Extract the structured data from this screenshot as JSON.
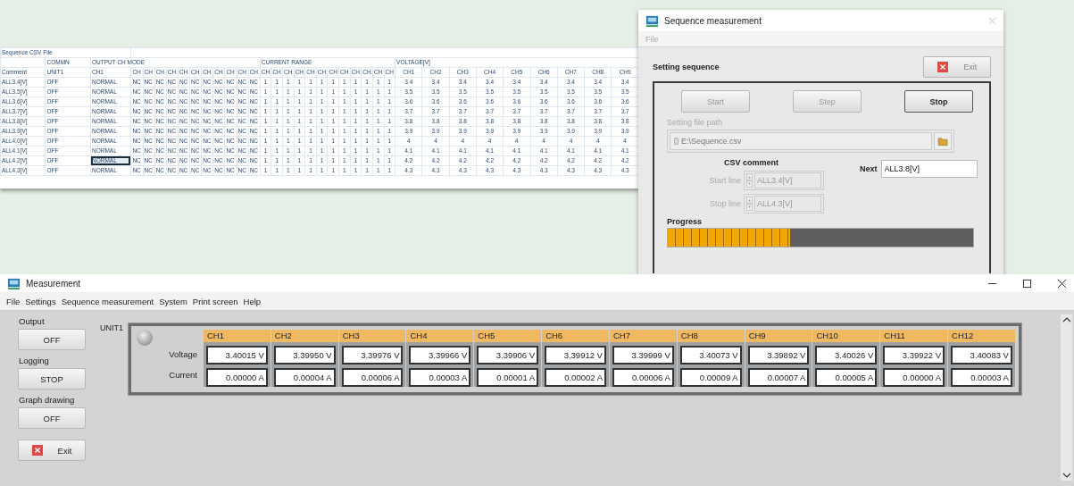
{
  "spreadsheet": {
    "title": "Sequence CSV File",
    "group_headers": [
      {
        "label": "COMMN",
        "kind": "unit"
      },
      {
        "label": "OUTPUT CH MODE",
        "kind": "mode"
      },
      {
        "label": "CURRENT RANGE",
        "kind": "range"
      },
      {
        "label": "VOLTAGE[V]",
        "kind": "voltage"
      }
    ],
    "columns": {
      "comment": "Comment",
      "unit": "UNIT1",
      "mode": [
        "CH1",
        "CH",
        "CH",
        "CH",
        "CH",
        "CH",
        "CH",
        "CH",
        "CH",
        "CH",
        "CH",
        "CH"
      ],
      "range": [
        "CH",
        "CH",
        "CH",
        "CH",
        "CH",
        "CH",
        "CH",
        "CH",
        "CH",
        "CH",
        "CH",
        "CH"
      ],
      "voltage": [
        "CH1",
        "CH2",
        "CH3",
        "CH4",
        "CH5",
        "CH6",
        "CH7",
        "CH8",
        "CH9"
      ]
    },
    "rows": [
      {
        "comment": "ALL3.4[V]",
        "unit": "OFF",
        "selected": false,
        "modes": [
          "NORMAL",
          "NC",
          "NC",
          "NC",
          "NC",
          "NC",
          "NC",
          "NC",
          "NC",
          "NC",
          "NC",
          "NC"
        ],
        "ranges": [
          "1",
          "1",
          "1",
          "1",
          "1",
          "1",
          "1",
          "1",
          "1",
          "1",
          "1",
          "1"
        ],
        "voltages": [
          "3.4",
          "3.4",
          "3.4",
          "3.4",
          "3.4",
          "3.4",
          "3.4",
          "3.4",
          "3.4"
        ]
      },
      {
        "comment": "ALL3.5[V]",
        "unit": "OFF",
        "selected": false,
        "modes": [
          "NORMAL",
          "NC",
          "NC",
          "NC",
          "NC",
          "NC",
          "NC",
          "NC",
          "NC",
          "NC",
          "NC",
          "NC"
        ],
        "ranges": [
          "1",
          "1",
          "1",
          "1",
          "1",
          "1",
          "1",
          "1",
          "1",
          "1",
          "1",
          "1"
        ],
        "voltages": [
          "3.5",
          "3.5",
          "3.5",
          "3.5",
          "3.5",
          "3.5",
          "3.5",
          "3.5",
          "3.5"
        ]
      },
      {
        "comment": "ALL3.6[V]",
        "unit": "OFF",
        "selected": false,
        "modes": [
          "NORMAL",
          "NC",
          "NC",
          "NC",
          "NC",
          "NC",
          "NC",
          "NC",
          "NC",
          "NC",
          "NC",
          "NC"
        ],
        "ranges": [
          "1",
          "1",
          "1",
          "1",
          "1",
          "1",
          "1",
          "1",
          "1",
          "1",
          "1",
          "1"
        ],
        "voltages": [
          "3.6",
          "3.6",
          "3.6",
          "3.6",
          "3.6",
          "3.6",
          "3.6",
          "3.6",
          "3.6"
        ]
      },
      {
        "comment": "ALL3.7[V]",
        "unit": "OFF",
        "selected": false,
        "modes": [
          "NORMAL",
          "NC",
          "NC",
          "NC",
          "NC",
          "NC",
          "NC",
          "NC",
          "NC",
          "NC",
          "NC",
          "NC"
        ],
        "ranges": [
          "1",
          "1",
          "1",
          "1",
          "1",
          "1",
          "1",
          "1",
          "1",
          "1",
          "1",
          "1"
        ],
        "voltages": [
          "3.7",
          "3.7",
          "3.7",
          "3.7",
          "3.7",
          "3.7",
          "3.7",
          "3.7",
          "3.7"
        ]
      },
      {
        "comment": "ALL3.8[V]",
        "unit": "OFF",
        "selected": false,
        "modes": [
          "NORMAL",
          "NC",
          "NC",
          "NC",
          "NC",
          "NC",
          "NC",
          "NC",
          "NC",
          "NC",
          "NC",
          "NC"
        ],
        "ranges": [
          "1",
          "1",
          "1",
          "1",
          "1",
          "1",
          "1",
          "1",
          "1",
          "1",
          "1",
          "1"
        ],
        "voltages": [
          "3.8",
          "3.8",
          "3.8",
          "3.8",
          "3.8",
          "3.8",
          "3.8",
          "3.8",
          "3.8"
        ]
      },
      {
        "comment": "ALL3.9[V]",
        "unit": "OFF",
        "selected": false,
        "modes": [
          "NORMAL",
          "NC",
          "NC",
          "NC",
          "NC",
          "NC",
          "NC",
          "NC",
          "NC",
          "NC",
          "NC",
          "NC"
        ],
        "ranges": [
          "1",
          "1",
          "1",
          "1",
          "1",
          "1",
          "1",
          "1",
          "1",
          "1",
          "1",
          "1"
        ],
        "voltages": [
          "3.9",
          "3.9",
          "3.9",
          "3.9",
          "3.9",
          "3.9",
          "3.9",
          "3.9",
          "3.9"
        ]
      },
      {
        "comment": "ALL4.0[V]",
        "unit": "OFF",
        "selected": false,
        "modes": [
          "NORMAL",
          "NC",
          "NC",
          "NC",
          "NC",
          "NC",
          "NC",
          "NC",
          "NC",
          "NC",
          "NC",
          "NC"
        ],
        "ranges": [
          "1",
          "1",
          "1",
          "1",
          "1",
          "1",
          "1",
          "1",
          "1",
          "1",
          "1",
          "1"
        ],
        "voltages": [
          "4",
          "4",
          "4",
          "4",
          "4",
          "4",
          "4",
          "4",
          "4"
        ]
      },
      {
        "comment": "ALL4.1[V]",
        "unit": "OFF",
        "selected": false,
        "modes": [
          "NORMAL",
          "NC",
          "NC",
          "NC",
          "NC",
          "NC",
          "NC",
          "NC",
          "NC",
          "NC",
          "NC",
          "NC"
        ],
        "ranges": [
          "1",
          "1",
          "1",
          "1",
          "1",
          "1",
          "1",
          "1",
          "1",
          "1",
          "1",
          "1"
        ],
        "voltages": [
          "4.1",
          "4.1",
          "4.1",
          "4.1",
          "4.1",
          "4.1",
          "4.1",
          "4.1",
          "4.1"
        ]
      },
      {
        "comment": "ALL4.2[V]",
        "unit": "OFF",
        "selected": true,
        "modes": [
          "NORMAL",
          "NC",
          "NC",
          "NC",
          "NC",
          "NC",
          "NC",
          "NC",
          "NC",
          "NC",
          "NC",
          "NC"
        ],
        "ranges": [
          "1",
          "1",
          "1",
          "1",
          "1",
          "1",
          "1",
          "1",
          "1",
          "1",
          "1",
          "1"
        ],
        "voltages": [
          "4.2",
          "4.2",
          "4.2",
          "4.2",
          "4.2",
          "4.2",
          "4.2",
          "4.2",
          "4.2"
        ]
      },
      {
        "comment": "ALL4.3[V]",
        "unit": "OFF",
        "selected": false,
        "modes": [
          "NORMAL",
          "NC",
          "NC",
          "NC",
          "NC",
          "NC",
          "NC",
          "NC",
          "NC",
          "NC",
          "NC",
          "NC"
        ],
        "ranges": [
          "1",
          "1",
          "1",
          "1",
          "1",
          "1",
          "1",
          "1",
          "1",
          "1",
          "1",
          "1"
        ],
        "voltages": [
          "4.3",
          "4.3",
          "4.3",
          "4.3",
          "4.3",
          "4.3",
          "4.3",
          "4.3",
          "4.3"
        ]
      }
    ]
  },
  "sequence_window": {
    "title": "Sequence measurement",
    "menu": [
      {
        "label": "File",
        "disabled": true
      }
    ],
    "section_label": "Setting sequence",
    "exit_button": "Exit",
    "buttons": [
      {
        "label": "Start",
        "disabled": true
      },
      {
        "label": "Step",
        "disabled": true
      },
      {
        "label": "Stop",
        "disabled": false
      }
    ],
    "file_path": {
      "label": "Setting file path",
      "value": "E:\\Sequence.csv",
      "disabled": true
    },
    "csv_comment": {
      "label": "CSV comment",
      "start": {
        "label": "Start line",
        "value": "ALL3.4[V]",
        "disabled": true
      },
      "stop": {
        "label": "Stop line",
        "value": "ALL4.3[V]",
        "disabled": true
      }
    },
    "next": {
      "label": "Next",
      "value": "ALL3.8[V]"
    },
    "progress": {
      "label": "Progress",
      "level": 0.4
    }
  },
  "measurement_window": {
    "title": "Measurement",
    "menu": [
      "File",
      "Settings",
      "Sequence measurement",
      "System",
      "Print screen",
      "Help"
    ],
    "controls": [
      {
        "label": "Output",
        "button": "OFF"
      },
      {
        "label": "Logging",
        "button": "STOP"
      },
      {
        "label": "Graph drawing",
        "button": "OFF"
      }
    ],
    "exit_button": "Exit",
    "unit": {
      "name": "UNIT1",
      "led_on": false,
      "row_labels": [
        "Voltage",
        "Current"
      ],
      "channels": [
        {
          "name": "CH1",
          "voltage": "3.40015 V",
          "current": "0.00000 A"
        },
        {
          "name": "CH2",
          "voltage": "3.39950 V",
          "current": "0.00004 A"
        },
        {
          "name": "CH3",
          "voltage": "3.39976 V",
          "current": "0.00006 A"
        },
        {
          "name": "CH4",
          "voltage": "3.39966 V",
          "current": "0.00003 A"
        },
        {
          "name": "CH5",
          "voltage": "3.39906 V",
          "current": "0.00001 A"
        },
        {
          "name": "CH6",
          "voltage": "3.39912 V",
          "current": "0.00002 A"
        },
        {
          "name": "CH7",
          "voltage": "3.39999 V",
          "current": "0.00006 A"
        },
        {
          "name": "CH8",
          "voltage": "3.40073 V",
          "current": "0.00009 A"
        },
        {
          "name": "CH9",
          "voltage": "3.39892 V",
          "current": "0.00007 A"
        },
        {
          "name": "CH10",
          "voltage": "3.40026 V",
          "current": "0.00005 A"
        },
        {
          "name": "CH11",
          "voltage": "3.39922 V",
          "current": "0.00000 A"
        },
        {
          "name": "CH12",
          "voltage": "3.40083 V",
          "current": "0.00003 A"
        }
      ]
    }
  }
}
